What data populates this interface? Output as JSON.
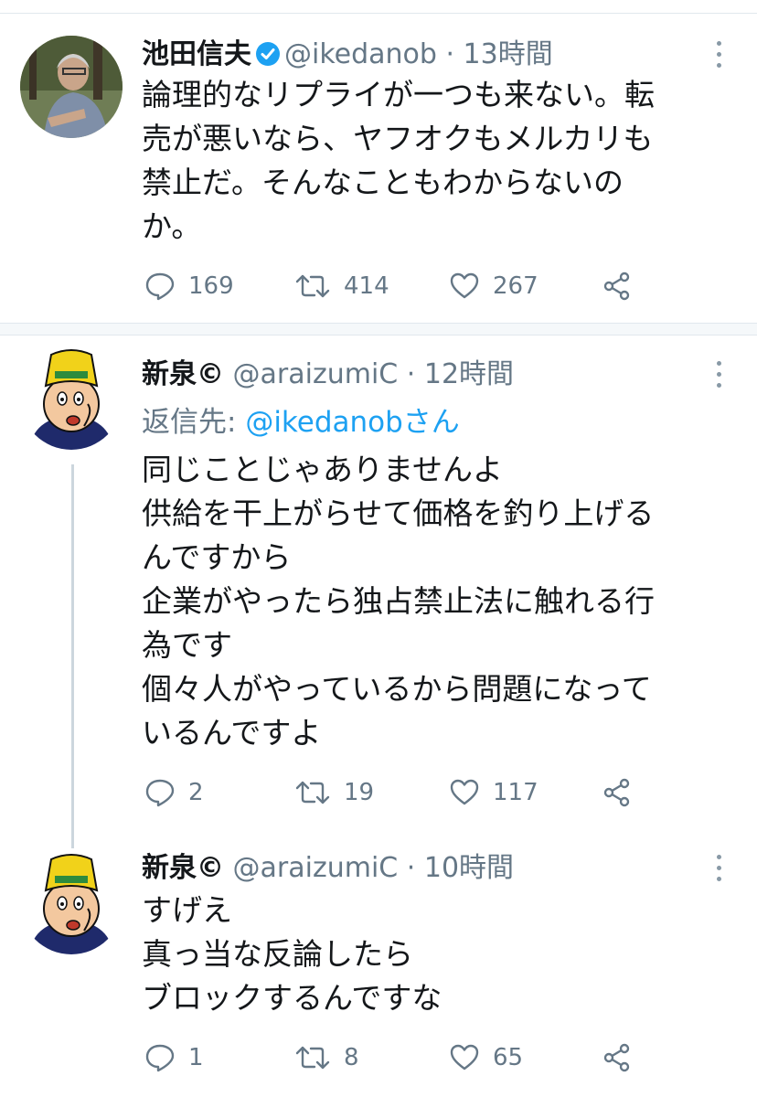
{
  "tweets": [
    {
      "name": "池田信夫",
      "handle": "@ikedanob",
      "time": "· 13時間",
      "verified": true,
      "lines": [
        "論理的なリプライが一つも来ない。転",
        "売が悪いなら、ヤフオクもメルカリも",
        "禁止だ。そんなこともわからないの",
        "か。"
      ],
      "replies": "169",
      "retweets": "414",
      "likes": "267"
    },
    {
      "name": "新泉©",
      "handle": "@araizumiC",
      "time": "· 12時間",
      "reply_prefix": "返信先: ",
      "reply_mention": "@ikedanobさん",
      "lines": [
        "同じことじゃありませんよ",
        "供給を干上がらせて価格を釣り上げる",
        "んですから",
        "企業がやったら独占禁止法に触れる行",
        "為です",
        "個々人がやっているから問題になって",
        "いるんですよ"
      ],
      "replies": "2",
      "retweets": "19",
      "likes": "117"
    },
    {
      "name": "新泉©",
      "handle": "@araizumiC",
      "time": "· 10時間",
      "lines": [
        "すげえ",
        "真っ当な反論したら",
        "ブロックするんですな"
      ],
      "replies": "1",
      "retweets": "8",
      "likes": "65"
    }
  ],
  "colors": {
    "text": "#14171a",
    "secondary": "#657786",
    "accent": "#1da1f2",
    "border": "#e1e8ed"
  }
}
